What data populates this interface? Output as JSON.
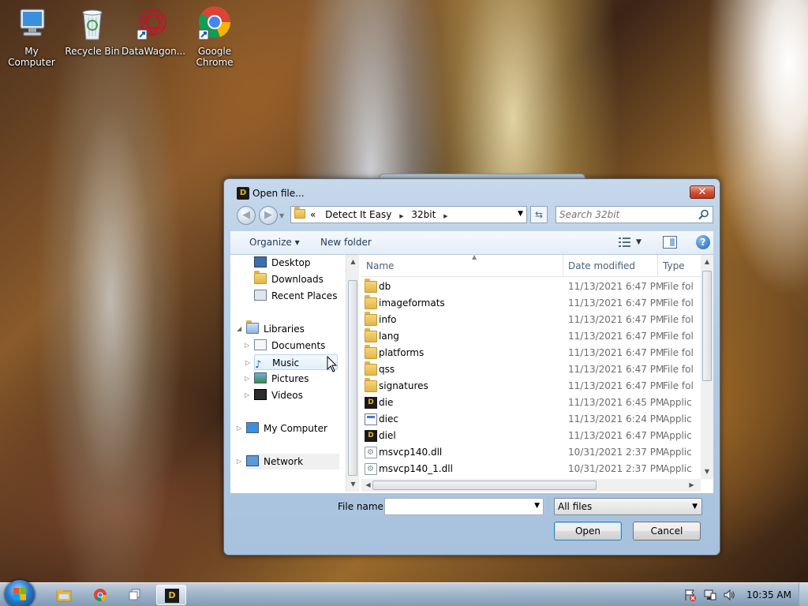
{
  "desktop": {
    "icons": [
      {
        "label": "My Computer",
        "icon": "computer-icon"
      },
      {
        "label": "Recycle Bin",
        "icon": "recycle-bin-icon"
      },
      {
        "label": "DataWagon...",
        "icon": "datawagon-icon"
      },
      {
        "label": "Google Chrome",
        "icon": "chrome-icon"
      }
    ]
  },
  "dialog": {
    "title": "Open file...",
    "close_glyph": "✕",
    "address": {
      "overflow": "«",
      "crumbs": [
        "Detect It Easy",
        "32bit"
      ],
      "separator": "▶"
    },
    "search_placeholder": "Search 32bit",
    "toolbar": {
      "organize": "Organize ▾",
      "new_folder": "New folder",
      "help": "?"
    },
    "nav": {
      "favorites": [
        "Desktop",
        "Downloads",
        "Recent Places"
      ],
      "libraries": "Libraries",
      "library_items": [
        "Documents",
        "Music",
        "Pictures",
        "Videos"
      ],
      "computer": "My Computer",
      "network": "Network"
    },
    "columns": {
      "name": "Name",
      "date": "Date modified",
      "type": "Type"
    },
    "files": [
      {
        "name": "db",
        "date": "11/13/2021 6:47 PM",
        "type": "File fol",
        "kind": "folder"
      },
      {
        "name": "imageformats",
        "date": "11/13/2021 6:47 PM",
        "type": "File fol",
        "kind": "folder"
      },
      {
        "name": "info",
        "date": "11/13/2021 6:47 PM",
        "type": "File fol",
        "kind": "folder"
      },
      {
        "name": "lang",
        "date": "11/13/2021 6:47 PM",
        "type": "File fol",
        "kind": "folder"
      },
      {
        "name": "platforms",
        "date": "11/13/2021 6:47 PM",
        "type": "File fol",
        "kind": "folder"
      },
      {
        "name": "qss",
        "date": "11/13/2021 6:47 PM",
        "type": "File fol",
        "kind": "folder"
      },
      {
        "name": "signatures",
        "date": "11/13/2021 6:47 PM",
        "type": "File fol",
        "kind": "folder"
      },
      {
        "name": "die",
        "date": "11/13/2021 6:45 PM",
        "type": "Applic",
        "kind": "die"
      },
      {
        "name": "diec",
        "date": "11/13/2021 6:24 PM",
        "type": "Applic",
        "kind": "exe"
      },
      {
        "name": "diel",
        "date": "11/13/2021 6:47 PM",
        "type": "Applic",
        "kind": "die"
      },
      {
        "name": "msvcp140.dll",
        "date": "10/31/2021 2:37 PM",
        "type": "Applic",
        "kind": "dll"
      },
      {
        "name": "msvcp140_1.dll",
        "date": "10/31/2021 2:37 PM",
        "type": "Applic",
        "kind": "dll"
      }
    ],
    "filename_label": "File name:",
    "filename_value": "",
    "filter_value": "All files",
    "open_label": "Open",
    "cancel_label": "Cancel"
  },
  "taskbar": {
    "clock": "10:35 AM",
    "apps": [
      "explorer-icon",
      "chrome-icon",
      "window-switch-icon",
      "die-app-icon"
    ]
  },
  "colors": {
    "accent": "#2d6fb2",
    "close": "#c9452d",
    "folder": "#e3b549"
  }
}
